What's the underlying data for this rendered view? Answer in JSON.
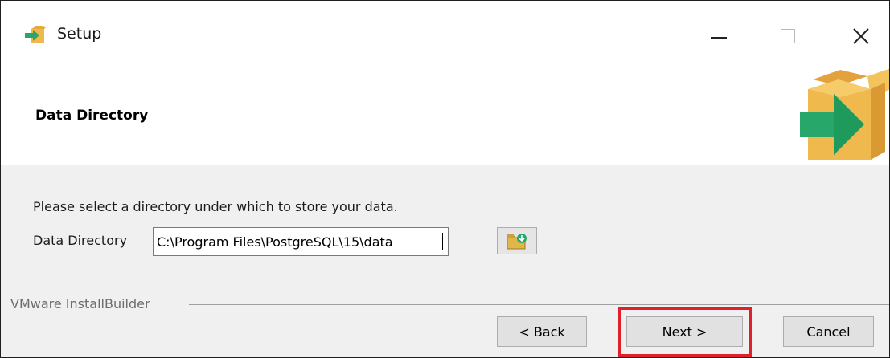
{
  "window": {
    "title": "Setup",
    "icon": "setup-box-arrow-icon"
  },
  "header": {
    "title": "Data Directory",
    "logo": "installer-box-arrow-logo"
  },
  "content": {
    "instruction": "Please select a directory under which to store your data.",
    "directory_label": "Data Directory",
    "directory_value": "C:\\Program Files\\PostgreSQL\\15\\data",
    "browse_icon": "folder-browse-icon"
  },
  "footer": {
    "brand": "VMware InstallBuilder",
    "back_label": "< Back",
    "next_label": "Next >",
    "cancel_label": "Cancel"
  },
  "colors": {
    "highlight": "#e0202a",
    "box": "#f0b94e",
    "arrow": "#27a86a"
  }
}
